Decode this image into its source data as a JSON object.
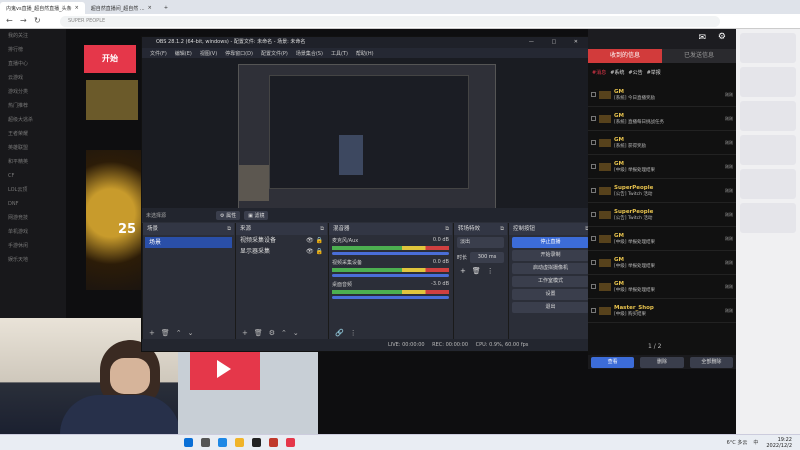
{
  "browser": {
    "tabs": [
      {
        "label": "内鬼vs直播_超自然直播_头条"
      },
      {
        "label": "超自然直播间_超自然 ..."
      }
    ],
    "url": "SUPER PEOPLE"
  },
  "site_sidebar": {
    "items": [
      "我的关注",
      "排行榜",
      "直播中心",
      "云游戏",
      "游戏分类",
      "热门推荐",
      "超级大逃杀",
      "王者荣耀",
      "英雄联盟",
      "和平精英",
      "CF",
      "LOL云顶",
      "DNF",
      "网游竞技",
      "单机游戏",
      "手游休闲",
      "娱乐天地"
    ]
  },
  "stream": {
    "start_label": "开始",
    "banner_number": "25"
  },
  "obs": {
    "title": "OBS 28.1.2 (64-bit, windows) - 配置文件: 未命名 - 场景: 未命名",
    "menu": [
      "文件(F)",
      "编辑(E)",
      "视图(V)",
      "停靠窗口(D)",
      "配置文件(P)",
      "场景集合(S)",
      "工具(T)",
      "帮助(H)"
    ],
    "scene_bar": {
      "label": "未选择源",
      "props_label": "属性",
      "filters_label": "滤镜"
    },
    "docks": {
      "scenes": {
        "title": "场景",
        "items": [
          "场景"
        ]
      },
      "sources": {
        "title": "来源",
        "items": [
          "视频采集设备",
          "显示器采集"
        ]
      },
      "mixer": {
        "title": "混音器",
        "channels": [
          {
            "name": "麦克风/Aux",
            "db": "0.0 dB"
          },
          {
            "name": "视频采集设备",
            "db": "0.0 dB"
          },
          {
            "name": "桌面音频",
            "db": "-3.0 dB"
          }
        ]
      },
      "transitions": {
        "title": "转场特效",
        "type": "淡出",
        "duration_label": "时长",
        "duration": "300 ms"
      },
      "controls": {
        "title": "控制按钮",
        "buttons": [
          "停止直播",
          "开始录制",
          "启动虚拟摄像机",
          "工作室模式",
          "设置",
          "退出"
        ]
      }
    },
    "status": {
      "live": "LIVE: 00:00:00",
      "rec": "REC: 00:00:00",
      "cpu": "CPU: 0.9%, 60.00 fps"
    }
  },
  "chat": {
    "tabs": [
      "收到的信息",
      "已发送信息"
    ],
    "subtabs": [
      "#消息",
      "#系统",
      "#公告",
      "#举报"
    ],
    "messages": [
      {
        "name": "GM",
        "text": "[系统] 今日直播奖励",
        "tag": "刚刚"
      },
      {
        "name": "GM",
        "text": "[系统] 直播每日挑战任务",
        "tag": "刚刚"
      },
      {
        "name": "GM",
        "text": "[系统] 获得奖励",
        "tag": "刚刚"
      },
      {
        "name": "GM",
        "text": "[中级] 举报处理结果",
        "tag": "刚刚"
      },
      {
        "name": "SuperPeople",
        "text": "[公告] Twitch 活动",
        "tag": "刚刚"
      },
      {
        "name": "SuperPeople",
        "text": "[公告] Twitch 活动",
        "tag": "刚刚"
      },
      {
        "name": "GM",
        "text": "[中级] 举报处理结果",
        "tag": "刚刚"
      },
      {
        "name": "GM",
        "text": "[中级] 举报处理结果",
        "tag": "刚刚"
      },
      {
        "name": "GM",
        "text": "[中级] 举报处理结果",
        "tag": "刚刚"
      },
      {
        "name": "Master_Shop",
        "text": "[中级] 购买结果",
        "tag": "刚刚"
      }
    ],
    "pager": "1 / 2",
    "footer_buttons": [
      "查看",
      "删除",
      "全部删除"
    ]
  },
  "taskbar": {
    "weather": "6°C 多云",
    "ime": "中",
    "time": "19:22",
    "date": "2022/12/2"
  },
  "colors": {
    "obs_accent": "#3c6cd8",
    "brand_red": "#e5374a",
    "chat_gold": "#e8c34e"
  }
}
